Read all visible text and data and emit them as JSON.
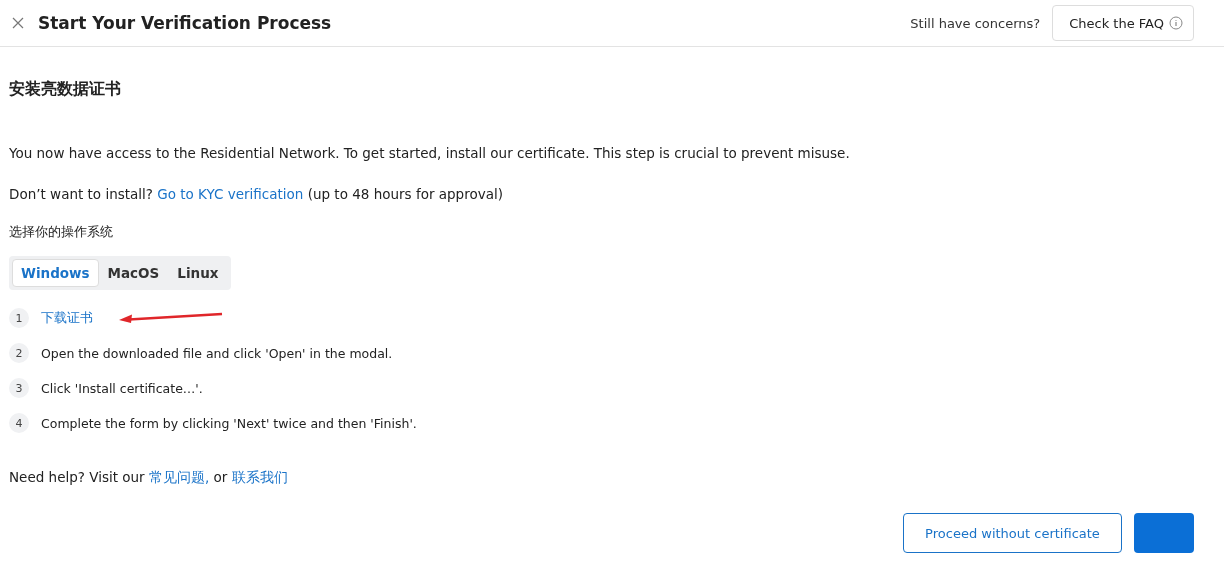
{
  "header": {
    "title": "Start Your Verification Process",
    "concerns": "Still have concerns?",
    "faq_button": "Check the FAQ"
  },
  "heading": "安装亮数据证书",
  "intro": "You now have access to the Residential Network. To get started, install our certificate. This step is crucial to prevent misuse.",
  "kyc": {
    "before": "Don’t want to install?",
    "link": "Go to KYC verification",
    "after": "(up to 48 hours for approval)"
  },
  "os_label": "选择你的操作系统",
  "tabs": [
    {
      "label": "Windows",
      "selected": true
    },
    {
      "label": "MacOS",
      "selected": false
    },
    {
      "label": "Linux",
      "selected": false
    }
  ],
  "steps": [
    {
      "number": "1",
      "text": "下载证书",
      "kind": "link"
    },
    {
      "number": "2",
      "text": "Open the downloaded file and click 'Open' in the modal.",
      "kind": "text"
    },
    {
      "number": "3",
      "text": "Click 'Install certificate…'.",
      "kind": "text"
    },
    {
      "number": "4",
      "text": "Complete the form by clicking 'Next' twice and then 'Finish'.",
      "kind": "text"
    }
  ],
  "help": {
    "before": "Need help? Visit our",
    "faq_link": "常见问题,",
    "middle": "or",
    "contact_link": "联系我们"
  },
  "footer": {
    "secondary_button": "Proceed without certificate"
  }
}
